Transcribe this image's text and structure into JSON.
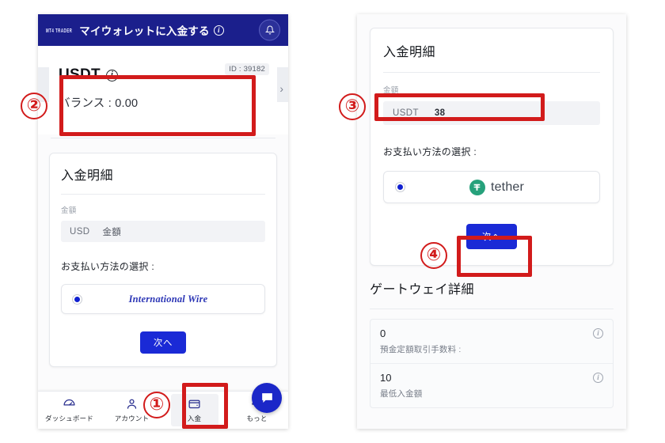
{
  "left_panel": {
    "appbar": {
      "brand": "MT4 TRADER",
      "title": "マイウォレットに入金する",
      "info_icon": "info-icon",
      "bell_icon": "bell-icon"
    },
    "balance_card": {
      "symbol": "USDT",
      "info_icon": "info-icon",
      "id_badge": "ID : 39182",
      "balance": "バランス : 0.00",
      "next_chevron": "›"
    },
    "deposit_card": {
      "title": "入金明細",
      "amount_label": "金額",
      "currency": "USD",
      "amount_placeholder": "金額",
      "pay_method_label": "お支払い方法の選択 :",
      "method": "International Wire",
      "next_button": "次へ"
    },
    "bottom_nav": [
      {
        "label": "ダッシュボード",
        "icon": "dashboard-gauge-icon",
        "active": false
      },
      {
        "label": "アカウント",
        "icon": "account-icon",
        "active": false
      },
      {
        "label": "入金",
        "icon": "wallet-icon",
        "active": true
      },
      {
        "label": "もっと",
        "icon": "more-icon",
        "active": false
      }
    ],
    "chat_fab_icon": "chat-bubble-icon"
  },
  "right_panel": {
    "deposit_card": {
      "title": "入金明細",
      "amount_label": "金額",
      "currency": "USDT",
      "amount_value": "38",
      "pay_method_label": "お支払い方法の選択 :",
      "method": "tether",
      "method_icon": "tether-logo-icon",
      "next_button": "次へ"
    },
    "gateway": {
      "title": "ゲートウェイ詳細",
      "rows": [
        {
          "value": "0",
          "caption": "預金定額取引手数料 :",
          "icon": "info-icon"
        },
        {
          "value": "10",
          "caption": "最低入金額",
          "icon": "info-icon"
        }
      ]
    }
  },
  "annotations": [
    {
      "number": "①"
    },
    {
      "number": "②"
    },
    {
      "number": "③"
    },
    {
      "number": "④"
    }
  ],
  "colors": {
    "appbar_navy": "#1b1f8c",
    "annotation_red": "#d21b1b",
    "primary_blue": "#1a2ad6",
    "tether_green": "#26a17b"
  }
}
